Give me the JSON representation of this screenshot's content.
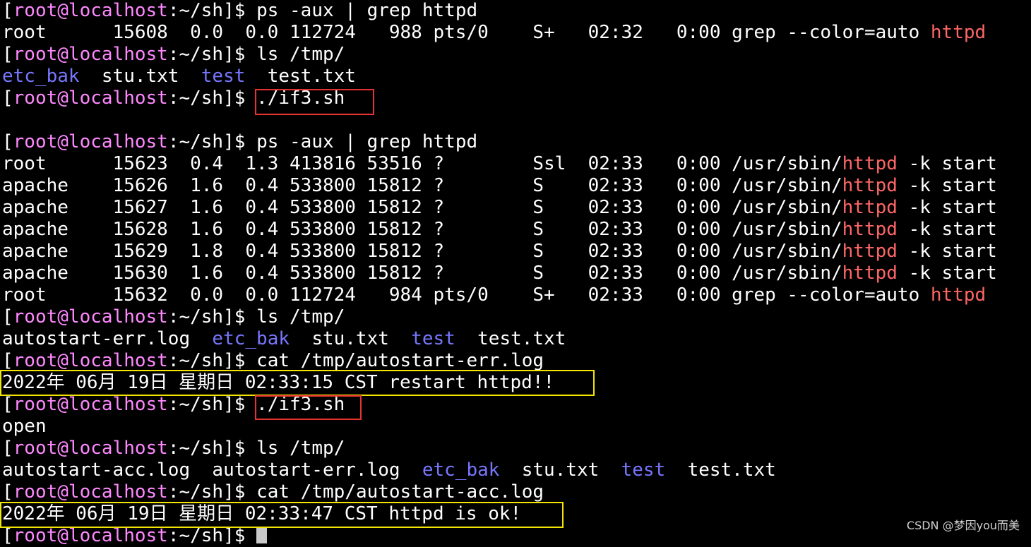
{
  "colors": {
    "background": "#000000",
    "text": "#ffffff",
    "prompt_user": "#ff88ff",
    "directory": "#7777ff",
    "grep_match": "#ff6666",
    "highlight_red": "#e8322f",
    "highlight_yellow": "#f2e500"
  },
  "prompt": {
    "open": "[",
    "user_host": "root@localhost",
    "path": ":~/sh",
    "close": "]$ "
  },
  "lines": [
    {
      "type": "prompt",
      "cmd": "ps -aux | grep httpd"
    },
    {
      "type": "proc",
      "pre": "root      15608  0.0  0.0 112724   988 pts/0    S+   02:32   0:00 grep --color=auto ",
      "match": "httpd",
      "post": ""
    },
    {
      "type": "prompt",
      "cmd": "ls /tmp/"
    },
    {
      "type": "ls",
      "items": [
        {
          "text": "etc_bak",
          "dir": true,
          "sep": "  "
        },
        {
          "text": "stu.txt",
          "dir": false,
          "sep": "  "
        },
        {
          "text": "test",
          "dir": true,
          "sep": "  "
        },
        {
          "text": "test.txt",
          "dir": false,
          "sep": ""
        }
      ]
    },
    {
      "type": "prompt",
      "cmd": "./if3.sh"
    },
    {
      "type": "text",
      "text": ""
    },
    {
      "type": "prompt",
      "cmd": "ps -aux | grep httpd"
    },
    {
      "type": "proc",
      "pre": "root      15623  0.4  1.3 413816 53516 ?        Ssl  02:33   0:00 /usr/sbin/",
      "match": "httpd",
      "post": " -k start"
    },
    {
      "type": "proc",
      "pre": "apache    15626  1.6  0.4 533800 15812 ?        S    02:33   0:00 /usr/sbin/",
      "match": "httpd",
      "post": " -k start"
    },
    {
      "type": "proc",
      "pre": "apache    15627  1.6  0.4 533800 15812 ?        S    02:33   0:00 /usr/sbin/",
      "match": "httpd",
      "post": " -k start"
    },
    {
      "type": "proc",
      "pre": "apache    15628  1.6  0.4 533800 15812 ?        S    02:33   0:00 /usr/sbin/",
      "match": "httpd",
      "post": " -k start"
    },
    {
      "type": "proc",
      "pre": "apache    15629  1.8  0.4 533800 15812 ?        S    02:33   0:00 /usr/sbin/",
      "match": "httpd",
      "post": " -k start"
    },
    {
      "type": "proc",
      "pre": "apache    15630  1.6  0.4 533800 15812 ?        S    02:33   0:00 /usr/sbin/",
      "match": "httpd",
      "post": " -k start"
    },
    {
      "type": "proc",
      "pre": "root      15632  0.0  0.0 112724   984 pts/0    S+   02:33   0:00 grep --color=auto ",
      "match": "httpd",
      "post": ""
    },
    {
      "type": "prompt",
      "cmd": "ls /tmp/"
    },
    {
      "type": "ls",
      "items": [
        {
          "text": "autostart-err.log",
          "dir": false,
          "sep": "  "
        },
        {
          "text": "etc_bak",
          "dir": true,
          "sep": "  "
        },
        {
          "text": "stu.txt",
          "dir": false,
          "sep": "  "
        },
        {
          "text": "test",
          "dir": true,
          "sep": "  "
        },
        {
          "text": "test.txt",
          "dir": false,
          "sep": ""
        }
      ]
    },
    {
      "type": "prompt",
      "cmd": "cat /tmp/autostart-err.log"
    },
    {
      "type": "text",
      "text": "2022年 06月 19日 星期日 02:33:15 CST restart httpd!!"
    },
    {
      "type": "prompt",
      "cmd": "./if3.sh"
    },
    {
      "type": "text",
      "text": "open"
    },
    {
      "type": "prompt",
      "cmd": "ls /tmp/"
    },
    {
      "type": "ls",
      "items": [
        {
          "text": "autostart-acc.log",
          "dir": false,
          "sep": "  "
        },
        {
          "text": "autostart-err.log",
          "dir": false,
          "sep": "  "
        },
        {
          "text": "etc_bak",
          "dir": true,
          "sep": "  "
        },
        {
          "text": "stu.txt",
          "dir": false,
          "sep": "  "
        },
        {
          "text": "test",
          "dir": true,
          "sep": "  "
        },
        {
          "text": "test.txt",
          "dir": false,
          "sep": ""
        }
      ]
    },
    {
      "type": "prompt",
      "cmd": "cat /tmp/autostart-acc.log"
    },
    {
      "type": "text",
      "text": "2022年 06月 19日 星期日 02:33:47 CST httpd is ok!"
    },
    {
      "type": "prompt",
      "cmd": "",
      "cursor": true
    }
  ],
  "watermark": "CSDN @梦因you而美"
}
